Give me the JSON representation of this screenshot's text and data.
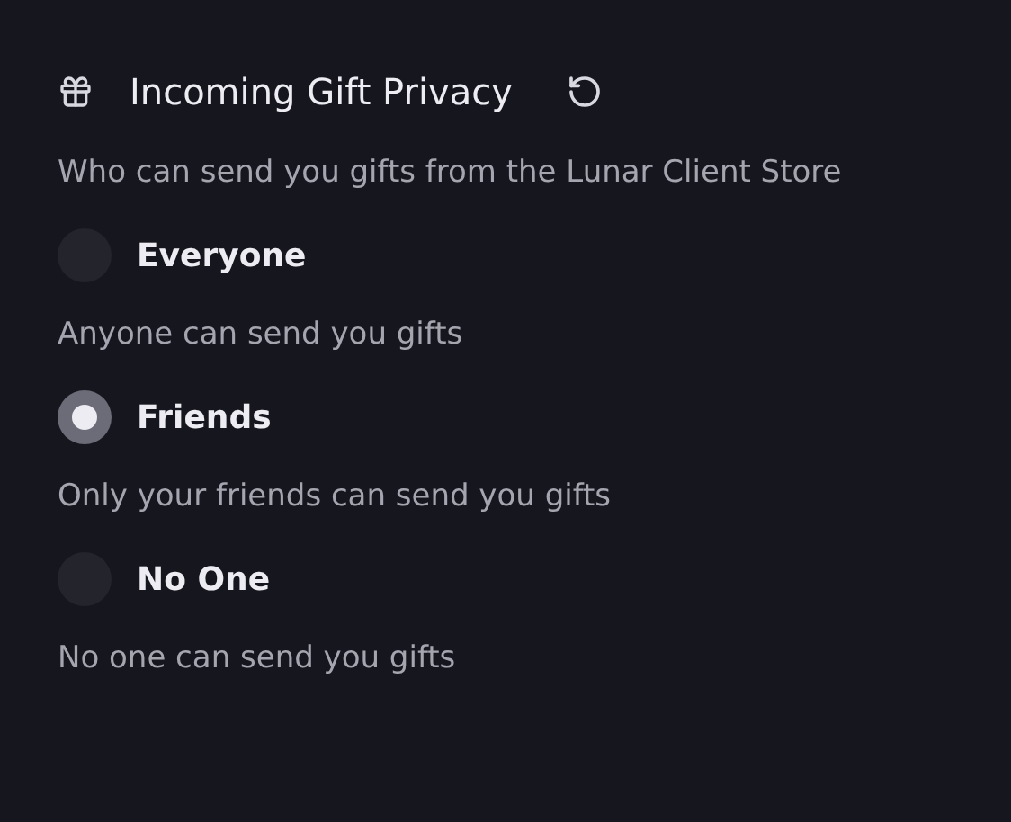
{
  "section": {
    "title": "Incoming Gift Privacy",
    "description": "Who can send you gifts from the Lunar Client Store"
  },
  "options": [
    {
      "label": "Everyone",
      "description": "Anyone can send you gifts",
      "selected": false
    },
    {
      "label": "Friends",
      "description": "Only your friends can send you gifts",
      "selected": true
    },
    {
      "label": "No One",
      "description": "No one can send you gifts",
      "selected": false
    }
  ]
}
